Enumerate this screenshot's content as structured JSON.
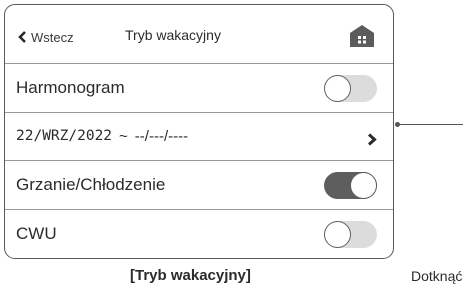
{
  "header": {
    "back_label": "Wstecz",
    "title": "Tryb wakacyjny",
    "home_icon": "home-icon"
  },
  "rows": {
    "schedule": {
      "label": "Harmonogram",
      "toggle_on": false
    },
    "date_range": {
      "start": "22/WRZ/2022",
      "separator": "~",
      "end": "--/---/----"
    },
    "heating_cooling": {
      "label": "Grzanie/Chłodzenie",
      "toggle_on": true
    },
    "dhw": {
      "label": "CWU",
      "toggle_on": false
    }
  },
  "caption": "[Tryb wakacyjny]",
  "side_note": "Dotknąć",
  "colors": {
    "border": "#595959",
    "toggle_on": "#5e5e5e",
    "toggle_off": "#dcdcdc",
    "text": "#2b2b2b"
  }
}
